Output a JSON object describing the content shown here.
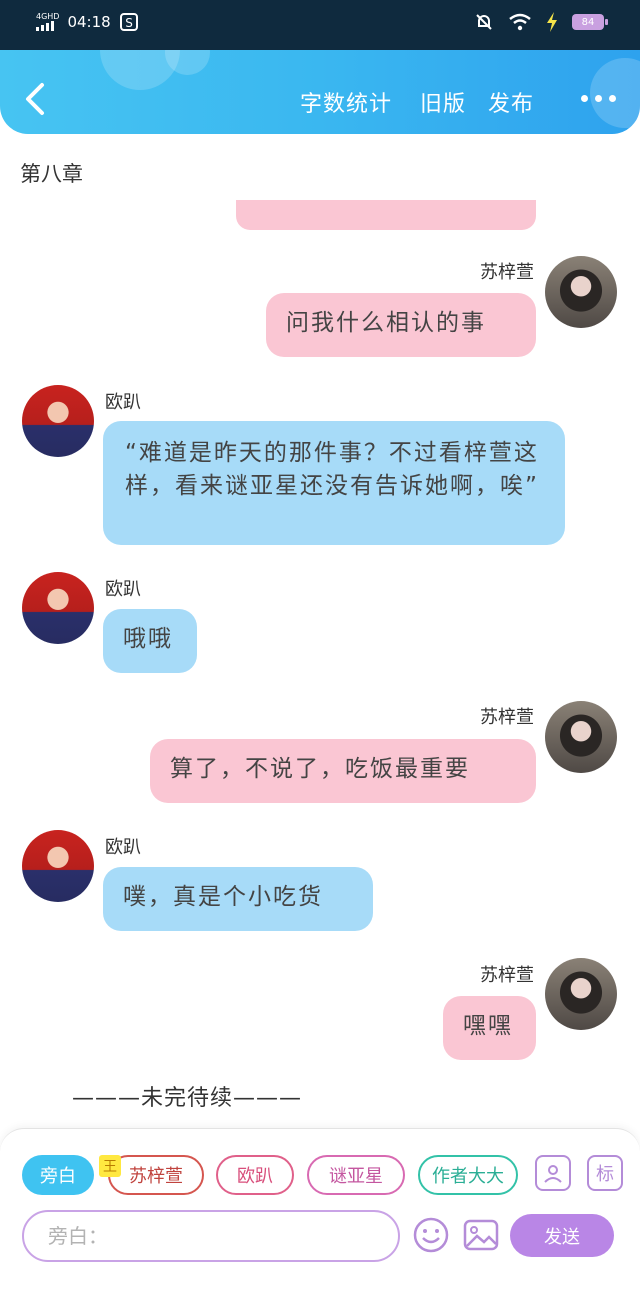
{
  "status_bar": {
    "network": "4GHD",
    "time": "04:18",
    "battery": "84"
  },
  "header": {
    "word_count": "字数统计",
    "old_version": "旧版",
    "publish": "发布"
  },
  "chapter_title": "第八章",
  "messages": [
    {
      "speaker": "苏梓萱",
      "text": "问我什么相认的事"
    },
    {
      "speaker": "欧趴",
      "text": "“难道是昨天的那件事？不过看梓萱这样，看来谜亚星还没有告诉她啊，唉”"
    },
    {
      "speaker": "欧趴",
      "text": "哦哦"
    },
    {
      "speaker": "苏梓萱",
      "text": "算了，不说了，吃饭最重要"
    },
    {
      "speaker": "欧趴",
      "text": "噗，真是个小吃货"
    },
    {
      "speaker": "苏梓萱",
      "text": "嘿嘿"
    }
  ],
  "ending": "———未完待续———",
  "roles": [
    "旁白",
    "苏梓萱",
    "欧趴",
    "谜亚星",
    "作者大大"
  ],
  "crown_badge": "王",
  "tag_button": "标",
  "input": {
    "placeholder": "旁白："
  },
  "send_label": "发送",
  "colors": {
    "header": "#3ab7f0",
    "pink_bubble": "#fac6d3",
    "blue_bubble": "#a7dbf8",
    "accent": "#b986e6"
  },
  "icons": [
    "back-arrow-icon",
    "more-dots-icon",
    "person-card-icon",
    "smiley-icon",
    "image-icon"
  ]
}
